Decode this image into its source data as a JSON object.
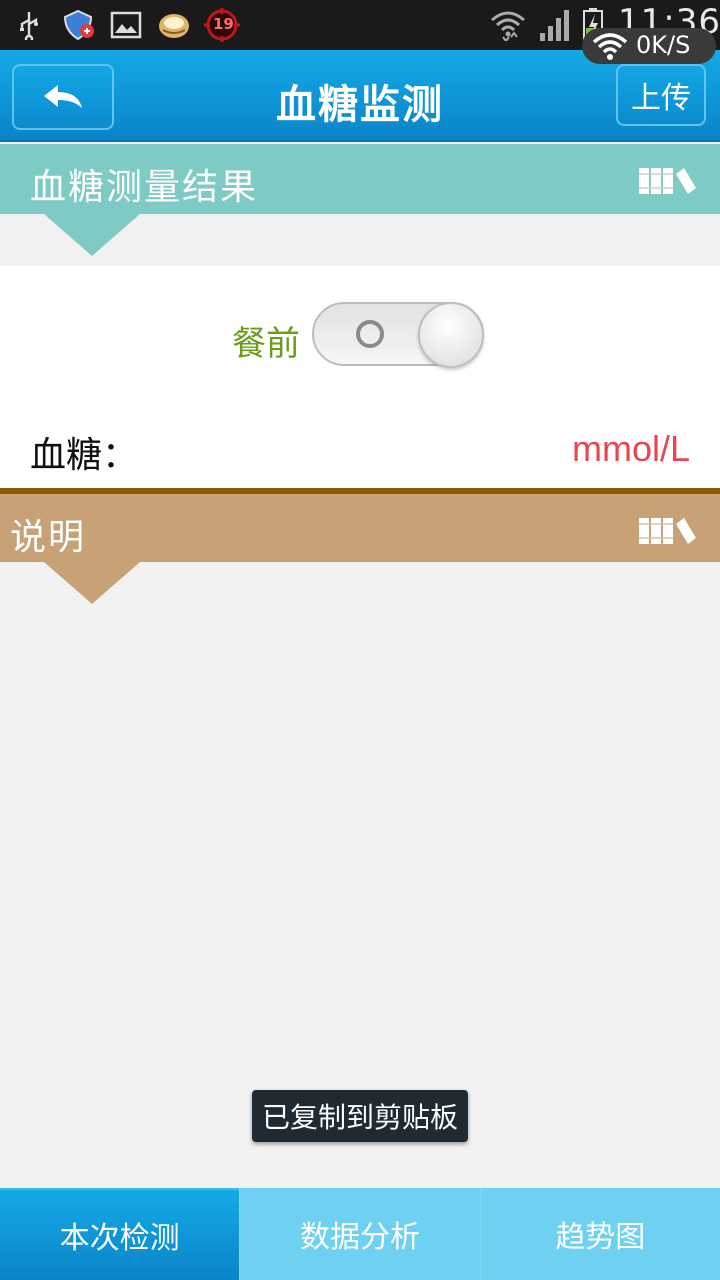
{
  "status_bar": {
    "time": "11:36",
    "net_speed": "0K/S",
    "notification_badge": "19",
    "icons": [
      "usb-icon",
      "shield-icon",
      "image-icon",
      "app-icon",
      "badge-icon",
      "wifi-icon",
      "signal-icon",
      "battery-icon"
    ]
  },
  "header": {
    "title": "血糖监测",
    "upload_label": "上传",
    "back_icon": "back-arrow-icon"
  },
  "section_result": {
    "title": "血糖测量结果",
    "icon": "books-icon",
    "color": "#7ecac4"
  },
  "measurement": {
    "toggle_label": "餐前",
    "glucose_label": "血糖：",
    "glucose_value": "",
    "glucose_unit": "mmol/L",
    "unit_color": "#e8464f"
  },
  "section_notes": {
    "title": "说明",
    "icon": "books-icon",
    "color": "#c8a276"
  },
  "toast": {
    "message": "已复制到剪贴板"
  },
  "tabs": [
    {
      "label": "本次检测",
      "active": true
    },
    {
      "label": "数据分析",
      "active": false
    },
    {
      "label": "趋势图",
      "active": false
    }
  ]
}
